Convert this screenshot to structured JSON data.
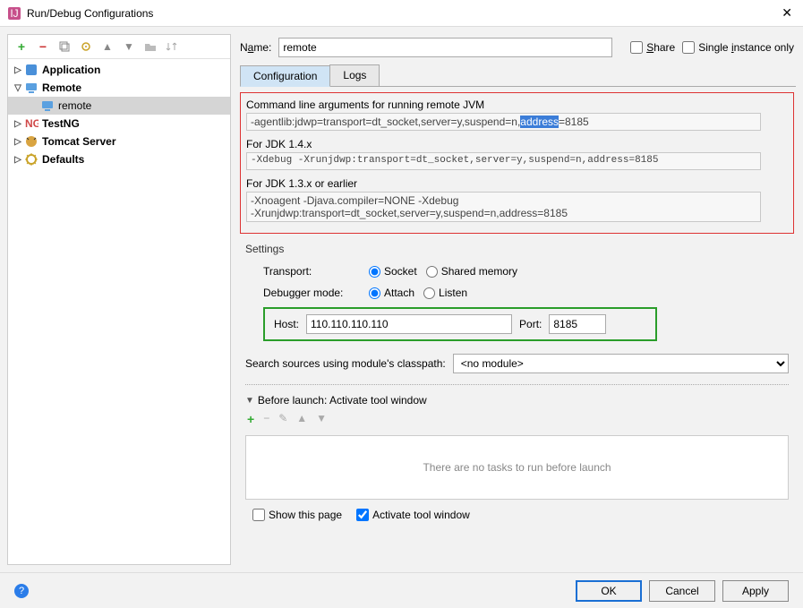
{
  "window": {
    "title": "Run/Debug Configurations"
  },
  "tree": {
    "items": [
      {
        "label": "Application",
        "expanded": false,
        "bold": true,
        "icon": "app"
      },
      {
        "label": "Remote",
        "expanded": true,
        "bold": true,
        "icon": "remote"
      },
      {
        "label": "remote",
        "child": true,
        "selected": true,
        "icon": "remote-leaf"
      },
      {
        "label": "TestNG",
        "expanded": false,
        "bold": true,
        "icon": "testng"
      },
      {
        "label": "Tomcat Server",
        "expanded": false,
        "bold": true,
        "icon": "tomcat"
      },
      {
        "label": "Defaults",
        "expanded": false,
        "bold": true,
        "icon": "defaults"
      }
    ]
  },
  "name": {
    "label_pre": "N",
    "label_u": "a",
    "label_post": "me:",
    "value": "remote"
  },
  "share": {
    "label": "Share"
  },
  "single": {
    "label_pre": "Single ",
    "label_u": "i",
    "label_post": "nstance only"
  },
  "tabs": {
    "config": "Configuration",
    "logs": "Logs"
  },
  "cmd": {
    "title": "Command line arguments for running remote JVM",
    "line1_pre": "-agentlib:jdwp=transport=dt_socket,server=y,suspend=n,",
    "line1_hl": "address",
    "line1_post": "=8185",
    "jdk14_label": "For JDK 1.4.x",
    "jdk14_line": "-Xdebug -Xrunjdwp:transport=dt_socket,server=y,suspend=n,address=8185",
    "jdk13_label": "For JDK 1.3.x or earlier",
    "jdk13_line1": "-Xnoagent -Djava.compiler=NONE -Xdebug",
    "jdk13_line2": "-Xrunjdwp:transport=dt_socket,server=y,suspend=n,address=8185"
  },
  "settings": {
    "title": "Settings",
    "transport_label": "Transport:",
    "transport_socket": "Socket",
    "transport_shared": "Shared memory",
    "debugger_label": "Debugger mode:",
    "debugger_attach": "Attach",
    "debugger_listen": "Listen",
    "host_label": "Host:",
    "host_value": "110.110.110.110",
    "port_label": "Port:",
    "port_value": "8185"
  },
  "search": {
    "label": "Search sources using module's classpath:",
    "value": "<no module>"
  },
  "before": {
    "title": "Before launch: Activate tool window",
    "empty": "There are no tasks to run before launch",
    "show": "Show this page",
    "activate": "Activate tool window"
  },
  "footer": {
    "ok": "OK",
    "cancel": "Cancel",
    "apply": "Apply"
  }
}
